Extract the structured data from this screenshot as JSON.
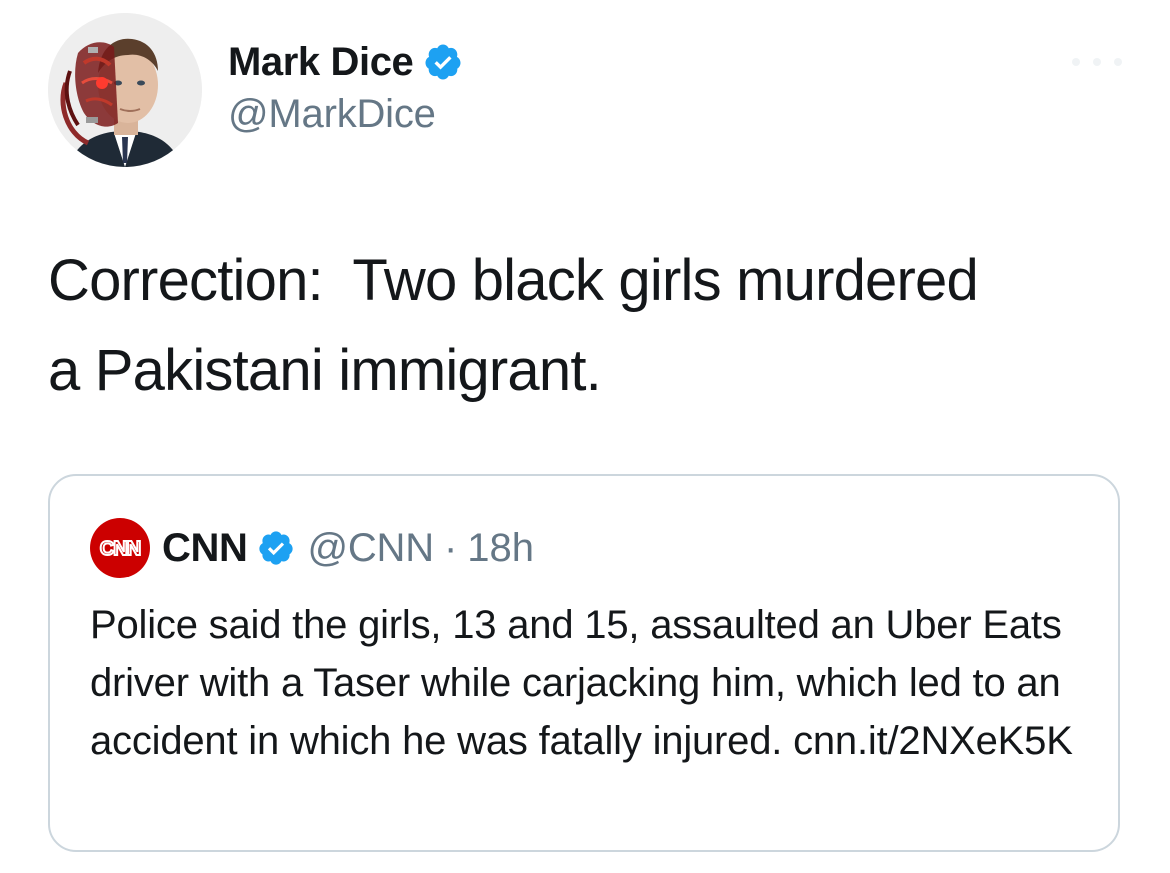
{
  "author": {
    "name": "Mark Dice",
    "handle": "@MarkDice",
    "verified": true
  },
  "tweet": {
    "text": "Correction:  Two black girls murdered\na Pakistani immigrant."
  },
  "quoted_tweet": {
    "logo_text": "CNN",
    "name": "CNN",
    "verified": true,
    "handle": "@CNN",
    "separator": "·",
    "time": "18h",
    "text": "Police said the girls, 13 and 15, assaulted an Uber Eats driver with a Taser while carjacking him, which led to an accident in which he was fatally injured. cnn.it/2NXeK5K"
  },
  "icons": {
    "verified": "verified-badge-icon",
    "more": "more-options-icon"
  },
  "colors": {
    "verified_blue": "#1da1f2",
    "cnn_red": "#cc0000",
    "secondary_text": "#657786",
    "border": "#ccd6dd"
  }
}
